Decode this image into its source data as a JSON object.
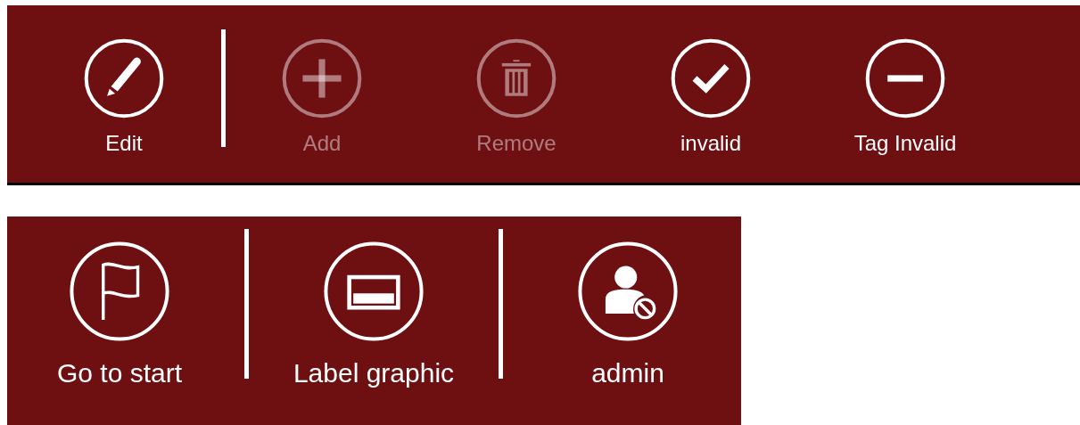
{
  "toolbars": [
    {
      "items": [
        {
          "kind": "button",
          "label": "Edit",
          "disabled": false
        },
        {
          "kind": "separator"
        },
        {
          "kind": "button",
          "label": "Add",
          "disabled": true
        },
        {
          "kind": "button",
          "label": "Remove",
          "disabled": true
        },
        {
          "kind": "button",
          "label": "invalid",
          "disabled": false
        },
        {
          "kind": "button",
          "label": "Tag Invalid",
          "disabled": false
        }
      ]
    },
    {
      "items": [
        {
          "kind": "button",
          "label": "Go to start",
          "disabled": false
        },
        {
          "kind": "separator"
        },
        {
          "kind": "button",
          "label": "Label graphic",
          "disabled": false
        },
        {
          "kind": "separator"
        },
        {
          "kind": "button",
          "label": "admin",
          "disabled": false
        }
      ]
    }
  ]
}
